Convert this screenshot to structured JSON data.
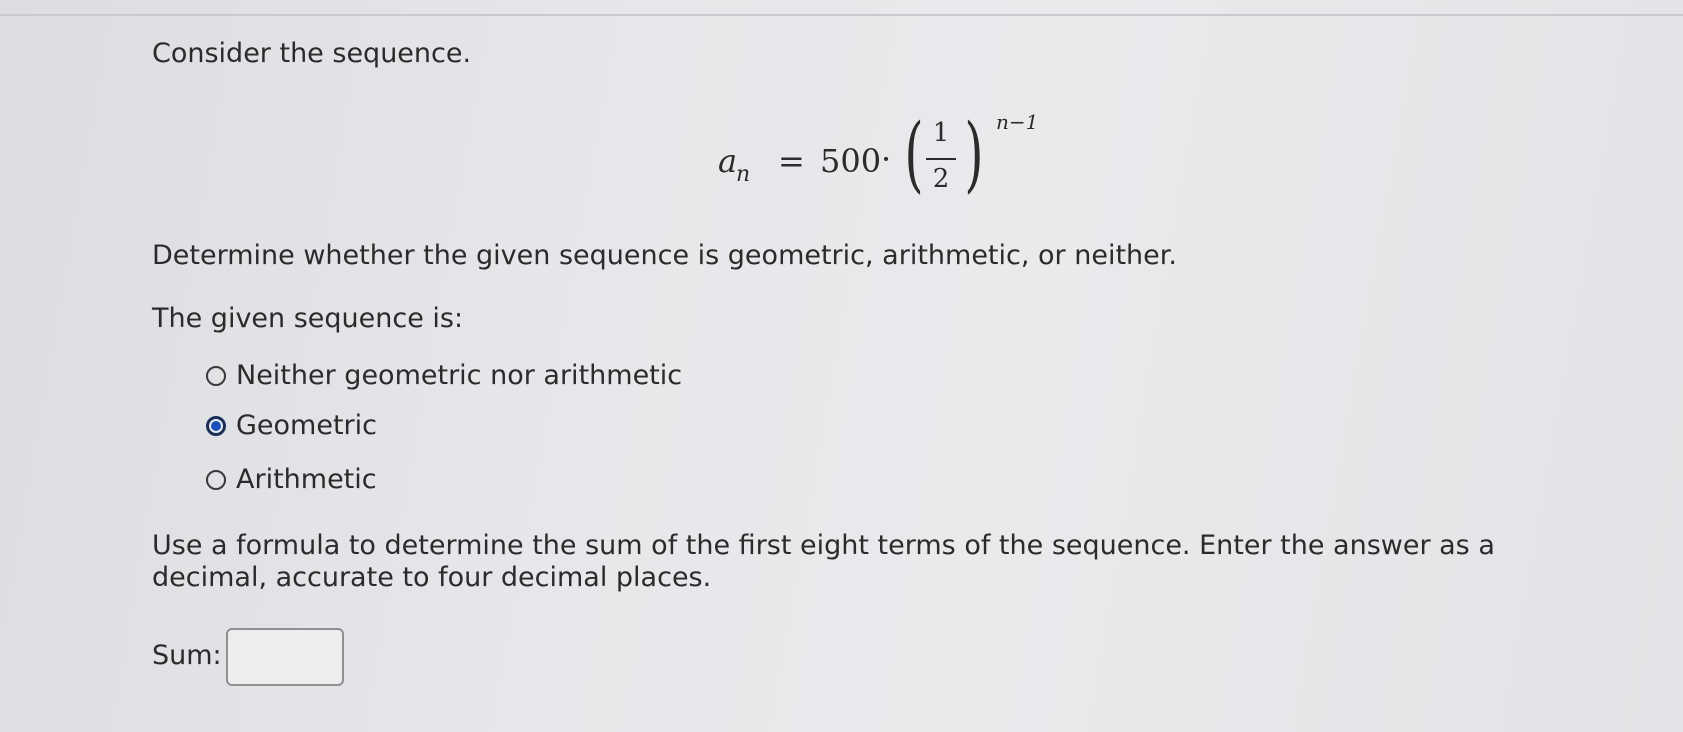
{
  "question": {
    "intro": "Consider the sequence.",
    "formula": {
      "lhs_var": "a",
      "lhs_sub": "n",
      "equals": "=",
      "coefficient": "500",
      "dot": "·",
      "paren_left": "(",
      "numerator": "1",
      "denominator": "2",
      "paren_right": ")",
      "exponent": "n−1"
    },
    "determine_text": "Determine whether the given sequence is geometric, arithmetic, or neither.",
    "given_label": "The given sequence is:",
    "options": [
      {
        "label": "Neither geometric nor arithmetic",
        "selected": false
      },
      {
        "label": "Geometric",
        "selected": true
      },
      {
        "label": "Arithmetic",
        "selected": false
      }
    ],
    "sum_instructions": "Use a formula to determine the sum of the first eight terms of the sequence. Enter the answer as a decimal, accurate to four decimal places.",
    "sum_label": "Sum:",
    "sum_value": ""
  },
  "colors": {
    "radio_selected": "#1d4fb6",
    "text": "#2b2b2b"
  }
}
